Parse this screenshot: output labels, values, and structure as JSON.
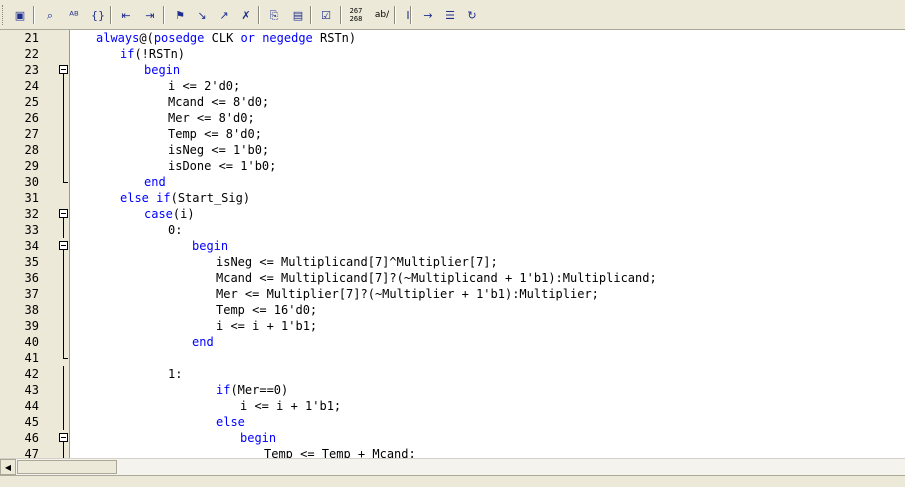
{
  "toolbar": {
    "buttons": [
      {
        "name": "window-icon",
        "glyph": "▣"
      },
      {
        "name": "find-icon",
        "glyph": "⌕"
      },
      {
        "name": "replace-icon",
        "glyph": "ᴬᴮ"
      },
      {
        "name": "braces-icon",
        "glyph": "{}"
      },
      {
        "name": "indent-decrease-icon",
        "glyph": "⇤"
      },
      {
        "name": "indent-increase-icon",
        "glyph": "⇥"
      },
      {
        "name": "bookmark-toggle-icon",
        "glyph": "⚑"
      },
      {
        "name": "bookmark-next-icon",
        "glyph": "↘"
      },
      {
        "name": "bookmark-prev-icon",
        "glyph": "↗"
      },
      {
        "name": "bookmark-clear-icon",
        "glyph": "✗"
      },
      {
        "name": "insert-file-icon",
        "glyph": "⎘"
      },
      {
        "name": "template-icon",
        "glyph": "▤"
      },
      {
        "name": "check-icon",
        "glyph": "☑"
      },
      {
        "name": "line-number-icon",
        "glyph": "#"
      },
      {
        "name": "spell-check-icon",
        "glyph": "ab/"
      },
      {
        "name": "cursor-icon",
        "glyph": "I"
      },
      {
        "name": "tab-arrow-icon",
        "glyph": "→"
      },
      {
        "name": "list-icon",
        "glyph": "☰"
      },
      {
        "name": "refresh-icon",
        "glyph": "↻"
      }
    ],
    "line_number_label_top": "267",
    "line_number_label_bottom": "268",
    "spell_label": "ab/"
  },
  "editor": {
    "lines": [
      {
        "n": "21",
        "indent": 3,
        "tokens": [
          [
            "kw",
            "always"
          ],
          [
            "t",
            "@("
          ],
          [
            "kw",
            "posedge"
          ],
          [
            "t",
            " CLK "
          ],
          [
            "kw",
            "or"
          ],
          [
            "t",
            " "
          ],
          [
            "kw",
            "negedge"
          ],
          [
            "t",
            " RSTn)"
          ]
        ],
        "fold": "none"
      },
      {
        "n": "22",
        "indent": 6,
        "tokens": [
          [
            "kw",
            "if"
          ],
          [
            "t",
            "(!RSTn)"
          ]
        ],
        "fold": "none"
      },
      {
        "n": "23",
        "indent": 9,
        "tokens": [
          [
            "kw",
            "begin"
          ]
        ],
        "fold": "box"
      },
      {
        "n": "24",
        "indent": 12,
        "tokens": [
          [
            "t",
            "i <= 2'd0;"
          ]
        ],
        "fold": "line"
      },
      {
        "n": "25",
        "indent": 12,
        "tokens": [
          [
            "t",
            "Mcand <= 8'd0;"
          ]
        ],
        "fold": "line"
      },
      {
        "n": "26",
        "indent": 12,
        "tokens": [
          [
            "t",
            "Mer <= 8'd0;"
          ]
        ],
        "fold": "line"
      },
      {
        "n": "27",
        "indent": 12,
        "tokens": [
          [
            "t",
            "Temp <= 8'd0;"
          ]
        ],
        "fold": "line"
      },
      {
        "n": "28",
        "indent": 12,
        "tokens": [
          [
            "t",
            "isNeg <= 1'b0;"
          ]
        ],
        "fold": "line"
      },
      {
        "n": "29",
        "indent": 12,
        "tokens": [
          [
            "t",
            "isDone <= 1'b0;"
          ]
        ],
        "fold": "line"
      },
      {
        "n": "30",
        "indent": 9,
        "tokens": [
          [
            "kw",
            "end"
          ]
        ],
        "fold": "end"
      },
      {
        "n": "31",
        "indent": 6,
        "tokens": [
          [
            "kw",
            "else"
          ],
          [
            "t",
            " "
          ],
          [
            "kw",
            "if"
          ],
          [
            "t",
            "(Start_Sig)"
          ]
        ],
        "fold": "none"
      },
      {
        "n": "32",
        "indent": 9,
        "tokens": [
          [
            "kw",
            "case"
          ],
          [
            "t",
            "(i)"
          ]
        ],
        "fold": "box"
      },
      {
        "n": "33",
        "indent": 12,
        "tokens": [
          [
            "t",
            "0:"
          ]
        ],
        "fold": "line"
      },
      {
        "n": "34",
        "indent": 15,
        "tokens": [
          [
            "kw",
            "begin"
          ]
        ],
        "fold": "box"
      },
      {
        "n": "35",
        "indent": 18,
        "tokens": [
          [
            "t",
            "isNeg <= Multiplicand[7]^Multiplier[7];"
          ]
        ],
        "fold": "line"
      },
      {
        "n": "36",
        "indent": 18,
        "tokens": [
          [
            "t",
            "Mcand <= Multiplicand[7]?(~Multiplicand + 1'b1):Multiplicand;"
          ]
        ],
        "fold": "line"
      },
      {
        "n": "37",
        "indent": 18,
        "tokens": [
          [
            "t",
            "Mer <= Multiplier[7]?(~Multiplier + 1'b1):Multiplier;"
          ]
        ],
        "fold": "line"
      },
      {
        "n": "38",
        "indent": 18,
        "tokens": [
          [
            "t",
            "Temp <= 16'd0;"
          ]
        ],
        "fold": "line"
      },
      {
        "n": "39",
        "indent": 18,
        "tokens": [
          [
            "t",
            "i <= i + 1'b1;"
          ]
        ],
        "fold": "line"
      },
      {
        "n": "40",
        "indent": 15,
        "tokens": [
          [
            "kw",
            "end"
          ]
        ],
        "fold": "line"
      },
      {
        "n": "41",
        "indent": 0,
        "tokens": [],
        "fold": "end"
      },
      {
        "n": "42",
        "indent": 12,
        "tokens": [
          [
            "t",
            "1:"
          ]
        ],
        "fold": "line"
      },
      {
        "n": "43",
        "indent": 18,
        "tokens": [
          [
            "kw",
            "if"
          ],
          [
            "t",
            "(Mer==0)"
          ]
        ],
        "fold": "line"
      },
      {
        "n": "44",
        "indent": 21,
        "tokens": [
          [
            "t",
            "i <= i + 1'b1;"
          ]
        ],
        "fold": "line"
      },
      {
        "n": "45",
        "indent": 18,
        "tokens": [
          [
            "kw",
            "else"
          ]
        ],
        "fold": "line"
      },
      {
        "n": "46",
        "indent": 21,
        "tokens": [
          [
            "kw",
            "begin"
          ]
        ],
        "fold": "box"
      },
      {
        "n": "47",
        "indent": 24,
        "tokens": [
          [
            "t",
            "Temp <= Temp + Mcand;"
          ]
        ],
        "fold": "line"
      }
    ]
  },
  "scrollbar": {
    "left_arrow": "◀"
  }
}
